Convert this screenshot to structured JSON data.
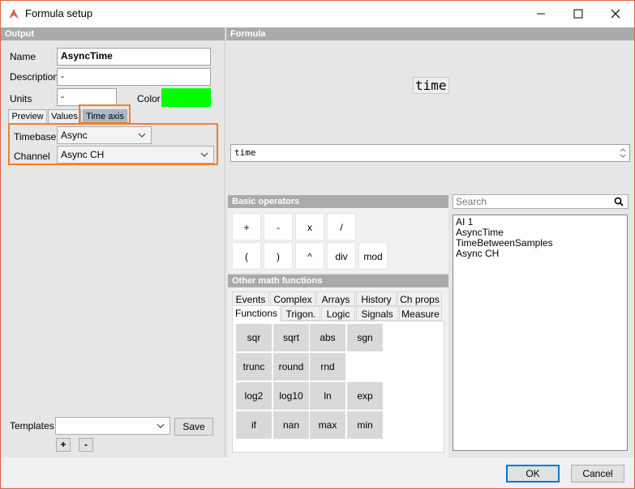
{
  "window": {
    "title": "Formula setup",
    "accent_color": "#e0614a"
  },
  "output": {
    "header": "Output",
    "name_label": "Name",
    "name_value": "AsyncTime",
    "description_label": "Description",
    "description_value": "-",
    "units_label": "Units",
    "units_value": "-",
    "color_label": "Color",
    "color_value": "#00ff00",
    "tabs": [
      {
        "label": "Preview"
      },
      {
        "label": "Values"
      },
      {
        "label": "Time axis"
      }
    ],
    "timebase_label": "Timebase",
    "timebase_value": "Async",
    "channel_label": "Channel",
    "channel_value": "Async CH",
    "templates_label": "Templates",
    "templates_value": "",
    "save_label": "Save",
    "add_label": "+",
    "remove_label": "-"
  },
  "formula": {
    "header": "Formula",
    "preview_text": "time",
    "input_value": "time"
  },
  "basic_operators": {
    "header": "Basic operators",
    "row1": [
      "+",
      "-",
      "x",
      "/"
    ],
    "row2": [
      "(",
      ")",
      "^",
      "div",
      "mod"
    ]
  },
  "other_math": {
    "header": "Other math functions",
    "tabs_row1": [
      "Events",
      "Complex",
      "Arrays",
      "History",
      "Ch props"
    ],
    "tabs_row2": [
      "Functions",
      "Trigon.",
      "Logic",
      "Signals",
      "Measure"
    ],
    "functions": [
      [
        "sqr",
        "sqrt",
        "abs",
        "sgn"
      ],
      [
        "trunc",
        "round",
        "rnd"
      ],
      [
        "log2",
        "log10",
        "ln",
        "exp"
      ],
      [
        "if",
        "nan",
        "max",
        "min"
      ]
    ]
  },
  "channels": {
    "search_placeholder": "Search",
    "items": [
      "AI 1",
      "AsyncTime",
      "TimeBetweenSamples",
      "Async CH"
    ]
  },
  "footer": {
    "ok_label": "OK",
    "cancel_label": "Cancel"
  }
}
